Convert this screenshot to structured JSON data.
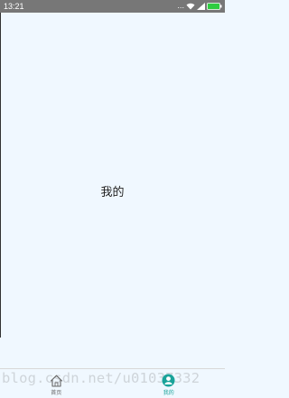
{
  "status_bar": {
    "time": "13:21",
    "dots": "...",
    "icons": [
      "signal-dots-icon",
      "wifi-icon",
      "signal-icon",
      "battery-icon"
    ]
  },
  "main": {
    "title": "我的"
  },
  "watermark": {
    "text": "blog.csdn.net/u01037332"
  },
  "tab_bar": {
    "tabs": [
      {
        "label": "首页",
        "icon": "home-icon",
        "active": false
      },
      {
        "label": "我的",
        "icon": "profile-icon",
        "active": true
      }
    ]
  },
  "colors": {
    "accent": "#1aa39a",
    "background": "#f0f8ff",
    "status_bar": "#777777"
  }
}
